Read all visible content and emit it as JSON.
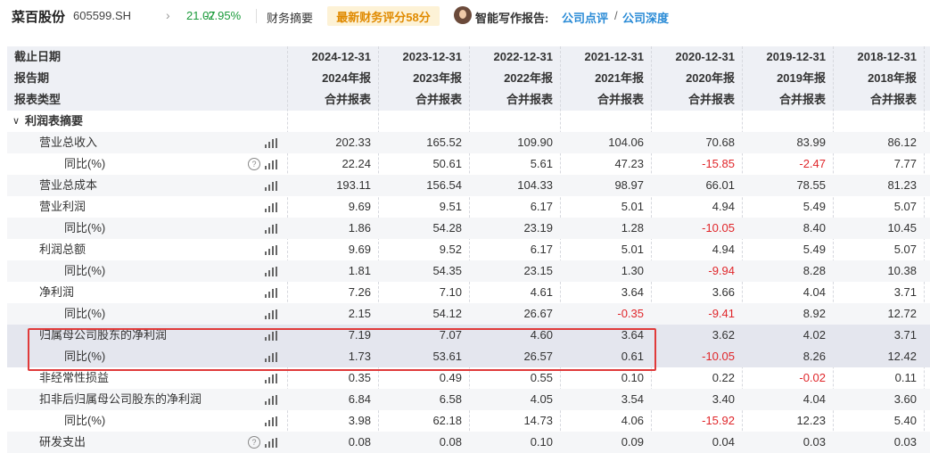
{
  "header": {
    "stock_name": "菜百股份",
    "stock_code": "605599.SH",
    "price": "21.07",
    "change": "-2.95%",
    "fin_summary": "财务摘要",
    "score_badge": "最新财务评分58分",
    "ai_label": "智能写作报告:",
    "link_review": "公司点评",
    "slash": "/",
    "link_depth": "公司深度"
  },
  "columns": {
    "labels": [
      "截止日期",
      "报告期",
      "报表类型"
    ],
    "dates": [
      "2024-12-31",
      "2023-12-31",
      "2022-12-31",
      "2021-12-31",
      "2020-12-31",
      "2019-12-31",
      "2018-12-31"
    ],
    "periods": [
      "2024年报",
      "2023年报",
      "2022年报",
      "2021年报",
      "2020年报",
      "2019年报",
      "2018年报"
    ],
    "types": [
      "合并报表",
      "合并报表",
      "合并报表",
      "合并报表",
      "合并报表",
      "合并报表",
      "合并报表"
    ]
  },
  "section_title": "利润表摘要",
  "rows": [
    {
      "label": "营业总收入",
      "values": [
        "202.33",
        "165.52",
        "109.90",
        "104.06",
        "70.68",
        "83.99",
        "86.12"
      ]
    },
    {
      "label": "同比(%)",
      "values": [
        "22.24",
        "50.61",
        "5.61",
        "47.23",
        "-15.85",
        "-2.47",
        "7.77"
      ]
    },
    {
      "label": "营业总成本",
      "values": [
        "193.11",
        "156.54",
        "104.33",
        "98.97",
        "66.01",
        "78.55",
        "81.23"
      ]
    },
    {
      "label": "营业利润",
      "values": [
        "9.69",
        "9.51",
        "6.17",
        "5.01",
        "4.94",
        "5.49",
        "5.07"
      ]
    },
    {
      "label": "同比(%)",
      "values": [
        "1.86",
        "54.28",
        "23.19",
        "1.28",
        "-10.05",
        "8.40",
        "10.45"
      ]
    },
    {
      "label": "利润总额",
      "values": [
        "9.69",
        "9.52",
        "6.17",
        "5.01",
        "4.94",
        "5.49",
        "5.07"
      ]
    },
    {
      "label": "同比(%)",
      "values": [
        "1.81",
        "54.35",
        "23.15",
        "1.30",
        "-9.94",
        "8.28",
        "10.38"
      ]
    },
    {
      "label": "净利润",
      "values": [
        "7.26",
        "7.10",
        "4.61",
        "3.64",
        "3.66",
        "4.04",
        "3.71"
      ]
    },
    {
      "label": "同比(%)",
      "values": [
        "2.15",
        "54.12",
        "26.67",
        "-0.35",
        "-9.41",
        "8.92",
        "12.72"
      ]
    },
    {
      "label": "归属母公司股东的净利润",
      "values": [
        "7.19",
        "7.07",
        "4.60",
        "3.64",
        "3.62",
        "4.02",
        "3.71"
      ]
    },
    {
      "label": "同比(%)",
      "values": [
        "1.73",
        "53.61",
        "26.57",
        "0.61",
        "-10.05",
        "8.26",
        "12.42"
      ]
    },
    {
      "label": "非经常性损益",
      "values": [
        "0.35",
        "0.49",
        "0.55",
        "0.10",
        "0.22",
        "-0.02",
        "0.11"
      ]
    },
    {
      "label": "扣非后归属母公司股东的净利润",
      "values": [
        "6.84",
        "6.58",
        "4.05",
        "3.54",
        "3.40",
        "4.04",
        "3.60"
      ]
    },
    {
      "label": "同比(%)",
      "values": [
        "3.98",
        "62.18",
        "14.73",
        "4.06",
        "-15.92",
        "12.23",
        "5.40"
      ]
    },
    {
      "label": "研发支出",
      "values": [
        "0.08",
        "0.08",
        "0.10",
        "0.09",
        "0.04",
        "0.03",
        "0.03"
      ]
    }
  ],
  "colors": {
    "negative": "#e0262a",
    "positive_quote": "#1a9a3a",
    "accent": "#2a8bd6",
    "badge": "#e08a00",
    "highlight": "#e03a3a"
  },
  "icons": [
    "bar-chart-icon",
    "help-circle-icon",
    "chevron-right-icon",
    "caret-down-icon"
  ]
}
